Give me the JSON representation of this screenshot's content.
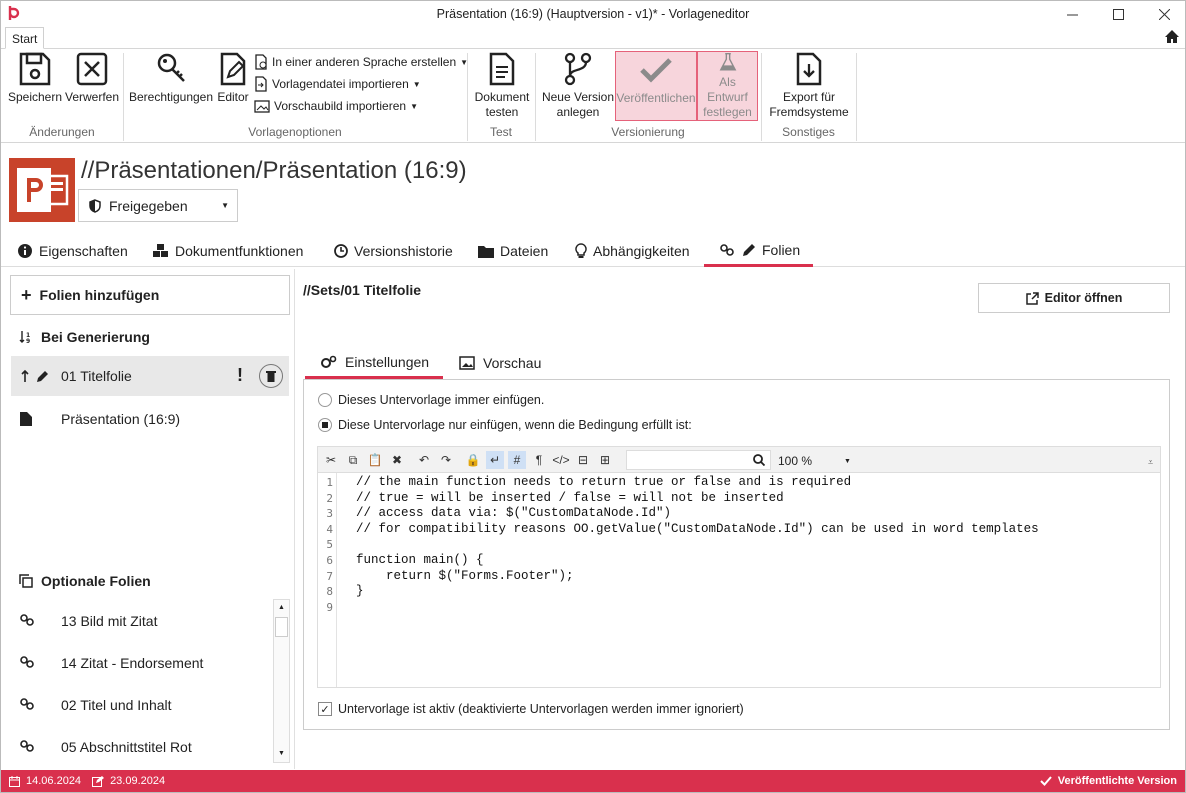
{
  "window": {
    "title": "Präsentation (16:9) (Hauptversion - v1)* - Vorlageneditor"
  },
  "ribbon": {
    "tab_label": "Start",
    "save": "Speichern",
    "discard": "Verwerfen",
    "permissions": "Berechtigungen",
    "editor": "Editor",
    "create_in_language": "In einer anderen Sprache erstellen",
    "import_template_file": "Vorlagendatei importieren",
    "import_preview": "Vorschaubild importieren",
    "doc_test_1": "Dokument",
    "doc_test_2": "testen",
    "new_version_1": "Neue Version",
    "new_version_2": "anlegen",
    "publish": "Veröffentlichen",
    "as_draft_1": "Als Entwurf",
    "as_draft_2": "festlegen",
    "export_1": "Export für",
    "export_2": "Fremdsysteme",
    "group_changes": "Änderungen",
    "group_template_options": "Vorlagenoptionen",
    "group_test": "Test",
    "group_versioning": "Versionierung",
    "group_misc": "Sonstiges"
  },
  "header": {
    "path": "//Präsentationen/Präsentation (16:9)",
    "status": "Freigegeben"
  },
  "tabs": {
    "properties": "Eigenschaften",
    "doc_functions": "Dokumentfunktionen",
    "version_history": "Versionshistorie",
    "files": "Dateien",
    "dependencies": "Abhängigkeiten",
    "slides": "Folien"
  },
  "left": {
    "add_slides": "Folien hinzufügen",
    "on_generation": "Bei Generierung",
    "gen_items": [
      "01 Titelfolie",
      "Präsentation (16:9)"
    ],
    "optional": "Optionale Folien",
    "optional_items": [
      "13 Bild mit Zitat",
      "14 Zitat - Endorsement",
      "02 Titel und Inhalt",
      "05 Abschnittstitel Rot"
    ]
  },
  "right": {
    "sub_path": "//Sets/01 Titelfolie",
    "open_editor": "Editor öffnen",
    "tab_settings": "Einstellungen",
    "tab_preview": "Vorschau",
    "radio_always": "Dieses Untervorlage immer einfügen.",
    "radio_condition": "Diese Untervorlage nur einfügen, wenn die Bedingung erfüllt ist:",
    "zoom": "100 %",
    "line_numbers": "1\n2\n3\n4\n5\n6\n7\n8\n9",
    "code": "// the main function needs to return true or false and is required\n// true = will be inserted / false = will not be inserted\n// access data via: $(\"CustomDataNode.Id\")\n// for compatibility reasons OO.getValue(\"CustomDataNode.Id\") can be used in word templates\n\nfunction main() {\n    return $(\"Forms.Footer\");\n}\n",
    "active_check": "Untervorlage ist aktiv (deaktivierte Untervorlagen werden immer ignoriert)"
  },
  "statusbar": {
    "created": "14.06.2024",
    "modified": "23.09.2024",
    "version_state": "Veröffentlichte Version"
  }
}
